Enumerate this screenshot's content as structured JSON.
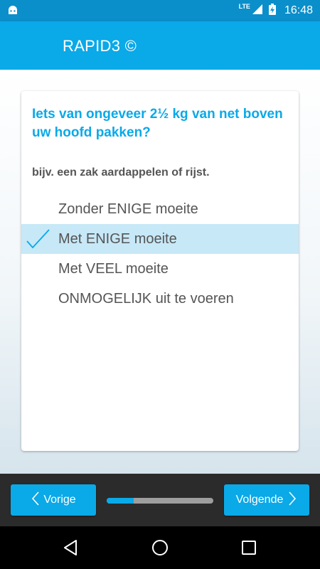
{
  "status_bar": {
    "network_label": "LTE",
    "time": "16:48",
    "icons": [
      "android-icon",
      "signal-icon",
      "battery-charging-icon"
    ]
  },
  "app_bar": {
    "title": "RAPID3 ©"
  },
  "question": {
    "text": "Iets van ongeveer 2½ kg van net boven uw hoofd pakken?",
    "hint": "bijv. een zak aardappelen of rijst.",
    "options": [
      {
        "label": "Zonder ENIGE moeite",
        "selected": false
      },
      {
        "label": "Met ENIGE moeite",
        "selected": true
      },
      {
        "label": "Met VEEL moeite",
        "selected": false
      },
      {
        "label": "ONMOGELIJK uit te voeren",
        "selected": false
      }
    ]
  },
  "navigation": {
    "prev_label": "Vorige",
    "next_label": "Volgende",
    "progress_fraction": 0.25
  },
  "colors": {
    "accent": "#0aa9e8",
    "status_bar": "#0a8fcb",
    "selected_row": "#c7e8f7"
  }
}
